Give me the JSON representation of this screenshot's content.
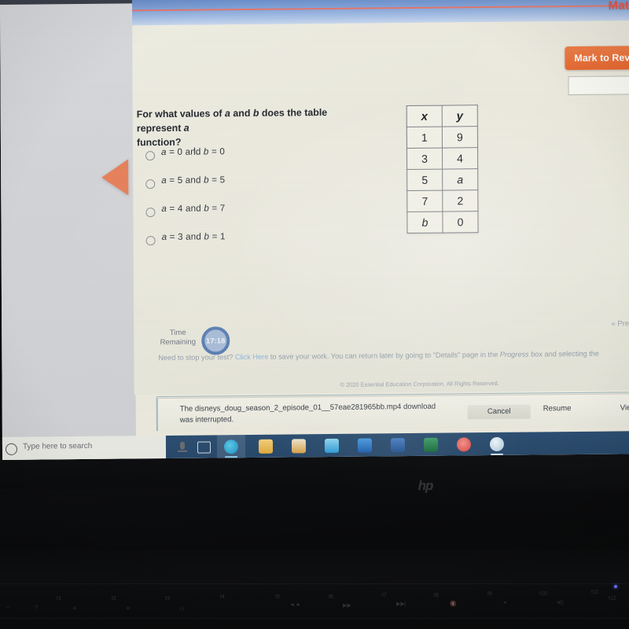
{
  "header": {
    "title": "Mat",
    "mark_review_label": "Mark to Rev"
  },
  "question": {
    "prompt_line1": "For what values of a and b does the table represent a",
    "prompt_line2": "function?",
    "options": [
      {
        "label": "a = 0 and b = 0",
        "selected": false
      },
      {
        "label": "a = 5 and b = 5",
        "selected": false
      },
      {
        "label": "a = 4 and b = 7",
        "selected": false
      },
      {
        "label": "a = 3 and b = 1",
        "selected": false
      }
    ]
  },
  "table": {
    "headers": [
      "x",
      "y"
    ],
    "rows": [
      [
        "1",
        "9"
      ],
      [
        "3",
        "4"
      ],
      [
        "5",
        "a"
      ],
      [
        "7",
        "2"
      ],
      [
        "b",
        "0"
      ]
    ]
  },
  "footer": {
    "timer_label_line1": "Time",
    "timer_label_line2": "Remaining",
    "timer_value": "17:18",
    "stop_note_pre": "Need to stop your test? ",
    "stop_note_link": "Click Here",
    "stop_note_mid": " to save your work. You can return later by going to \"Details\" page in the ",
    "stop_note_em": "Progress",
    "stop_note_post": " box and selecting the ",
    "prev_link": "« Pre",
    "copyright": "© 2020 Essential Education Corporation. All Rights Reserved."
  },
  "download_bar": {
    "message_line1": "The disneys_doug_season_2_episode_01__57eae281965bb.mp4 download",
    "message_line2": "was interrupted.",
    "cancel_label": "Cancel",
    "resume_label": "Resume",
    "view_label": "View d"
  },
  "taskbar": {
    "search_placeholder": "Type here to search",
    "icons": [
      {
        "name": "task-view-icon"
      },
      {
        "name": "edge-browser-icon",
        "color": "#3bb5e0"
      },
      {
        "name": "file-explorer-icon",
        "color": "#f0c05a"
      },
      {
        "name": "microsoft-store-icon",
        "color": "#d8a24a"
      },
      {
        "name": "mail-icon",
        "color": "#2e9bd6"
      },
      {
        "name": "outlook-icon",
        "color": "#1f6fc4"
      },
      {
        "name": "word-icon",
        "color": "#2b579a"
      },
      {
        "name": "excel-icon",
        "color": "#1e7145"
      },
      {
        "name": "media-icon",
        "color": "#e8605a"
      },
      {
        "name": "app-icon",
        "color": "#bcd8e6"
      }
    ]
  },
  "laptop": {
    "brand": "hp",
    "function_keys": [
      "f1",
      "f2",
      "f3",
      "f4",
      "f5",
      "f6",
      "f7",
      "f8",
      "f9",
      "f10",
      "f11",
      "f12"
    ]
  },
  "colors": {
    "accent_orange": "#e8662d",
    "header_red": "#e2554b",
    "header_blue": "#7ea0d6",
    "page_bg": "#eceade"
  }
}
